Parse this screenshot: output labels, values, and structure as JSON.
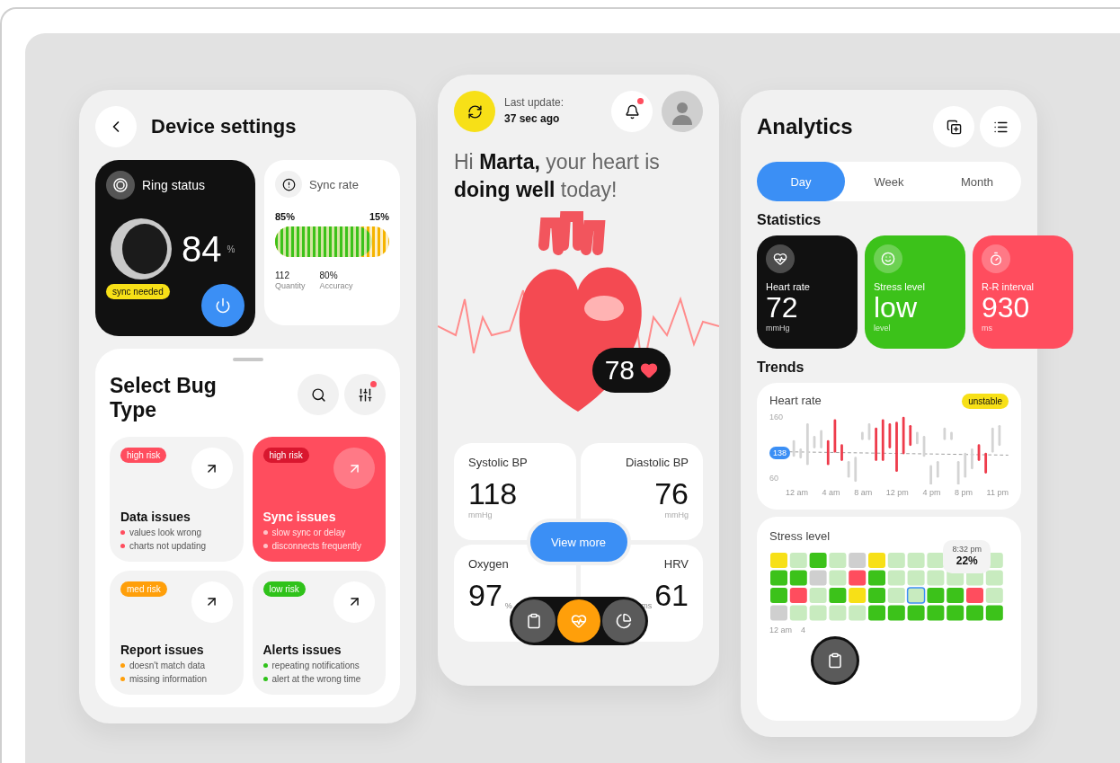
{
  "device_settings": {
    "title": "Device settings",
    "ring_status": {
      "title": "Ring status",
      "value": "84",
      "unit": "%",
      "badge": "sync needed"
    },
    "sync_rate": {
      "title": "Sync rate",
      "level": 0.85,
      "segments": [
        {
          "label": "85%"
        },
        {
          "label": "15%"
        }
      ],
      "stats": [
        {
          "value": "112",
          "label": "Quantity"
        },
        {
          "value": "80%",
          "label": "Accuracy"
        }
      ]
    }
  },
  "bug_types": {
    "title": "Select Bug Type",
    "filter_notification": true,
    "cards": [
      {
        "risk": "high risk",
        "color": "#ff4d5e",
        "title": "Data issues",
        "points": [
          "values look wrong",
          "charts not updating"
        ],
        "highlighted": false
      },
      {
        "risk": "high risk",
        "color": "#d9172f",
        "title": "Sync issues",
        "points": [
          "slow sync or delay",
          "disconnects frequently"
        ],
        "highlighted": true
      },
      {
        "risk": "med risk",
        "color": "#ff9f0a",
        "title": "Report issues",
        "points": [
          "doesn't match data",
          "missing information"
        ],
        "highlighted": false
      },
      {
        "risk": "low risk",
        "color": "#2fc21a",
        "title": "Alerts issues",
        "points": [
          "repeating notifications",
          "alert at the wrong time"
        ],
        "highlighted": false
      }
    ]
  },
  "dashboard": {
    "update_label": "Last update:",
    "update_time": "37 sec ago",
    "notification": true,
    "greeting": "Hi **Marta,** your heart is **doing well** today!",
    "bpm": "78",
    "metrics": [
      {
        "label": "Systolic BP",
        "value": "118",
        "unit": "mmHg"
      },
      {
        "label": "Diastolic BP",
        "value": "76",
        "unit": "mmHg"
      },
      {
        "label": "Oxygen",
        "value": "97",
        "unit": "%"
      },
      {
        "label": "HRV",
        "value": "61",
        "unit": "ms"
      }
    ],
    "view_more": "View more",
    "nav": [
      {
        "kind": "clipboard",
        "selected": false
      },
      {
        "kind": "heart",
        "selected": true
      },
      {
        "kind": "chart",
        "selected": false
      }
    ]
  },
  "analytics": {
    "title": "Analytics",
    "tabs": [
      {
        "label": "Day",
        "selected": true
      },
      {
        "label": "Week",
        "selected": false
      },
      {
        "label": "Month",
        "selected": false
      }
    ],
    "statistics_title": "Statistics",
    "statistics": [
      {
        "kind": "heart",
        "label": "Heart rate",
        "value": "72",
        "unit": "mmHg",
        "color": "#111111"
      },
      {
        "kind": "smile",
        "label": "Stress level",
        "value": "low",
        "unit": "level",
        "color": "#3cc21a"
      },
      {
        "kind": "timer",
        "label": "R-R interval",
        "value": "930",
        "unit": "ms",
        "color": "#ff4d5e"
      }
    ],
    "trends_title": "Trends",
    "heart_rate": {
      "title": "Heart rate",
      "badge": "unstable",
      "y_labels": [
        "160",
        "60"
      ],
      "marker": "138",
      "x_labels": [
        "12 am",
        "4 am",
        "8 am",
        "12 pm",
        "4 pm",
        "8 pm",
        "11 pm"
      ]
    },
    "stress": {
      "title": "Stress level",
      "tooltip_time": "8:32 pm",
      "tooltip_value": "22%",
      "x_labels": [
        "12 am",
        "4"
      ]
    },
    "nav": [
      {
        "kind": "clipboard",
        "selected": false
      }
    ]
  }
}
